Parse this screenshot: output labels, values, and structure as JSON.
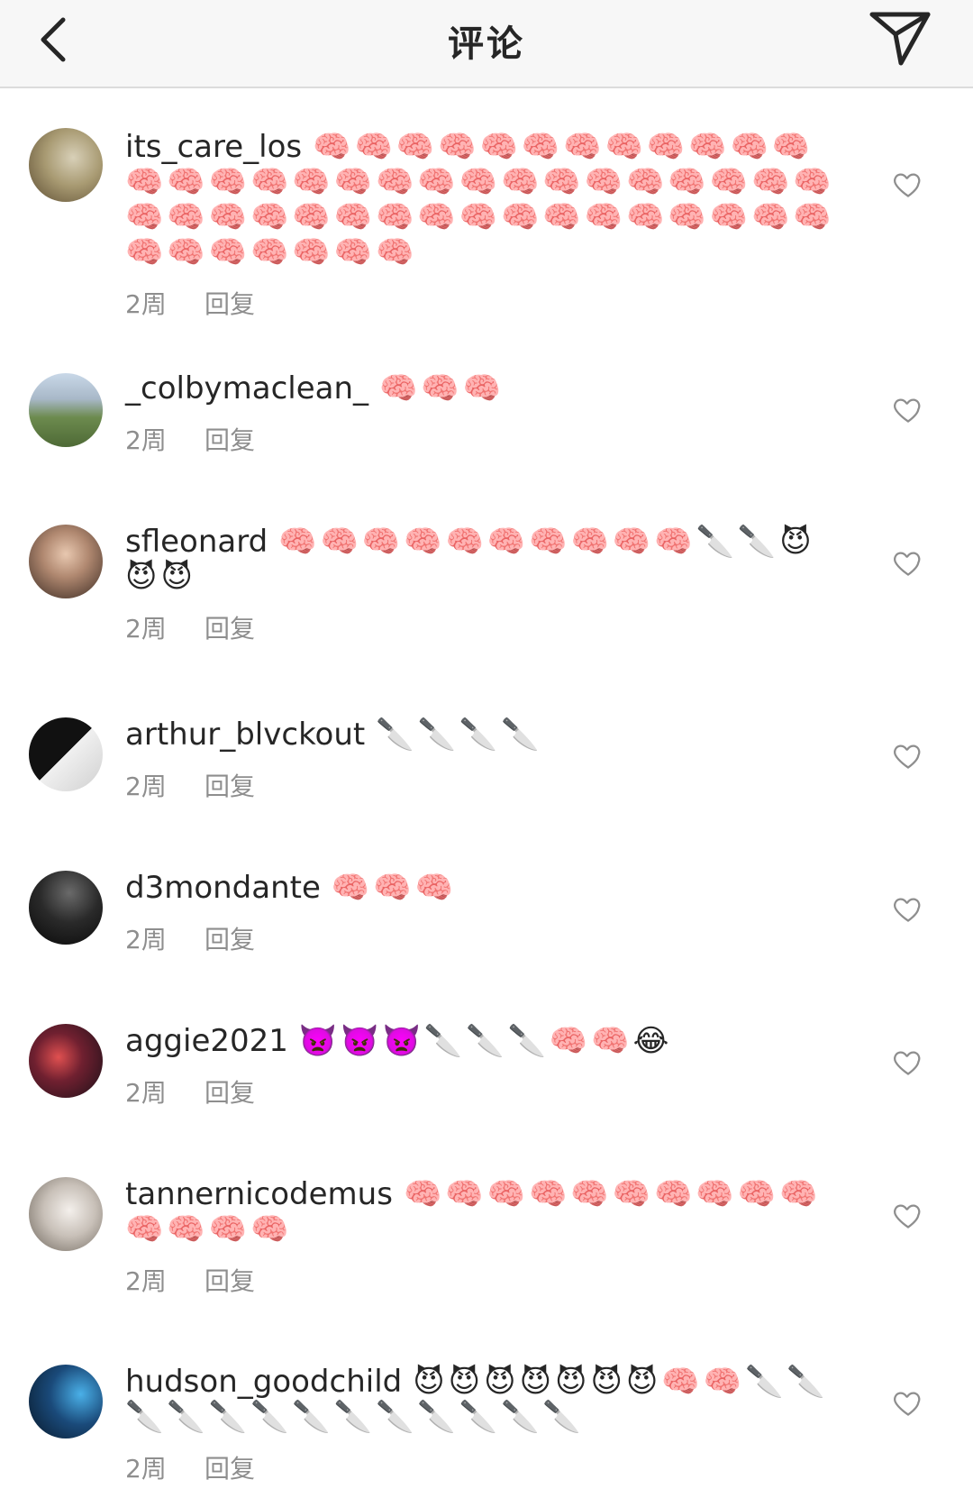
{
  "header": {
    "title": "评论",
    "back_icon": "chevron-left-icon",
    "send_icon": "paper-plane-icon"
  },
  "comments": [
    {
      "username": "its_care_los",
      "text": "🧠🧠🧠🧠🧠🧠🧠🧠🧠🧠🧠🧠🧠🧠🧠🧠🧠🧠🧠🧠🧠🧠🧠🧠🧠🧠🧠🧠🧠🧠🧠🧠🧠🧠🧠🧠🧠🧠🧠🧠🧠🧠🧠🧠🧠🧠🧠🧠🧠🧠🧠🧠🧠",
      "time": "2周",
      "reply": "回复"
    },
    {
      "username": "_colbymaclean_",
      "text": "🧠🧠🧠",
      "time": "2周",
      "reply": "回复"
    },
    {
      "username": "sfleonard",
      "text": "🧠🧠🧠🧠🧠🧠🧠🧠🧠🧠🔪🔪😈😈😈",
      "time": "2周",
      "reply": "回复"
    },
    {
      "username": "arthur_blvckout",
      "text": "🔪🔪🔪🔪",
      "time": "2周",
      "reply": "回复"
    },
    {
      "username": "d3mondante",
      "text": "🧠🧠🧠",
      "time": "2周",
      "reply": "回复"
    },
    {
      "username": "aggie2021",
      "text": "👿👿👿🔪🔪🔪🧠🧠😂",
      "time": "2周",
      "reply": "回复"
    },
    {
      "username": "tannernicodemus",
      "text": "🧠🧠🧠🧠🧠🧠🧠🧠🧠🧠🧠🧠🧠🧠",
      "time": "2周",
      "reply": "回复"
    },
    {
      "username": "hudson_goodchild",
      "text": "😈😈😈😈😈😈😈🧠🧠🔪🔪🔪🔪🔪🔪🔪🔪🔪🔪🔪🔪🔪",
      "time": "2周",
      "reply": "回复"
    }
  ],
  "colors": {
    "header_bg": "#f7f7f7",
    "text": "#262626",
    "meta_text": "#8e8e8e"
  }
}
